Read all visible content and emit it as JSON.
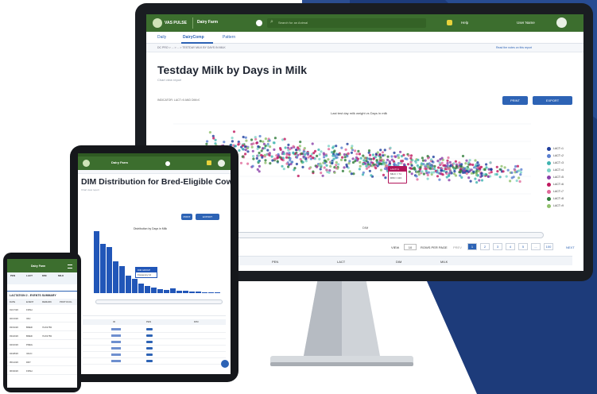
{
  "colors": {
    "brand_green": "#3c6e2e",
    "navy_background": "#1d3b7a",
    "accent_blue": "#2d63b5",
    "bar_blue": "#2156b8"
  },
  "monitor": {
    "brand": "VAS  PULSE",
    "farm_name": "Dairy Farm",
    "search_placeholder": "Search for an Animal",
    "top_right_help": "Help",
    "top_right_user": "User Name",
    "tabs": [
      "Daily",
      "DairyComp",
      "Pattern"
    ],
    "active_tab_index": 1,
    "breadcrumb": "DC PRO  >  ...  >  ...  >  TESTDAY MILK BY DAYS IN MILK",
    "breadcrumb_right": "Read the notes on this report",
    "page_title": "Testday Milk by Days in Milk",
    "page_subtitle": "Chart view report",
    "filter_label": "INDICATOR: LACT>0 AND DIM>0",
    "print_button": "PRINT",
    "export_button": "EXPORT",
    "chart_title": "Last test day milk weight vs Days in milk",
    "x_axis_title": "DIM",
    "legend": [
      "LACT=1",
      "LACT=2",
      "LACT=3",
      "LACT=4",
      "LACT=5",
      "LACT=6",
      "LACT=7",
      "LACT=8",
      "LACT=9"
    ],
    "tooltip_title": "LACT=1",
    "tooltip_line1": "MILK = 74",
    "tooltip_line2": "DIM = 413",
    "pagination_label": "VIEW",
    "pagination_rows": "10",
    "pagination_suffix": "ROWS PER PAGE",
    "pagination_pages": [
      "1",
      "2",
      "3",
      "4",
      "5",
      "...",
      "100"
    ],
    "pagination_prev": "PREV",
    "pagination_next": "NEXT",
    "table_headers": [
      "ID",
      "PEN",
      "LACT",
      "DIM",
      "MILK"
    ]
  },
  "tablet": {
    "farm_name": "Dairy Farm",
    "page_title": "DIM Distribution for Bred-Eligible Cows",
    "page_subtitle": "Chart view report",
    "button_1": "PRINT",
    "button_2": "EXPORT",
    "chart_title": "Distribution by Days in Milk",
    "tooltip_title": "DIM GROUP",
    "tooltip_value": "Frequency 14",
    "table_headers": [
      "ID",
      "PEN",
      "DIM"
    ]
  },
  "phone": {
    "farm_name": "Dairy Farm",
    "columns": [
      "PEN",
      "LACT",
      "DIM",
      "MILK"
    ],
    "section_title": "LACTATION 2 - EVENTS SUMMARY",
    "table_headers": [
      "DATE",
      "EVENT",
      "REMARK",
      "PROTOCOL"
    ],
    "rows": [
      {
        "date": "01/17/26",
        "event": "FRSH",
        "remark": "",
        "protocol": ""
      },
      {
        "date": "02/13/26",
        "event": "VAC",
        "remark": "",
        "protocol": ""
      },
      {
        "date": "03/01/26",
        "event": "BRED",
        "remark": "7HO1783",
        "protocol": ""
      },
      {
        "date": "03/22/26",
        "event": "BRED",
        "remark": "7HO1783",
        "protocol": ""
      },
      {
        "date": "04/10/26",
        "event": "PREG",
        "remark": "",
        "protocol": ""
      },
      {
        "date": "04/28/26",
        "event": "VACC",
        "remark": "",
        "protocol": ""
      },
      {
        "date": "05/14/26",
        "event": "DRY",
        "remark": "",
        "protocol": ""
      },
      {
        "date": "06/02/26",
        "event": "FRSH",
        "remark": "",
        "protocol": ""
      }
    ]
  }
}
